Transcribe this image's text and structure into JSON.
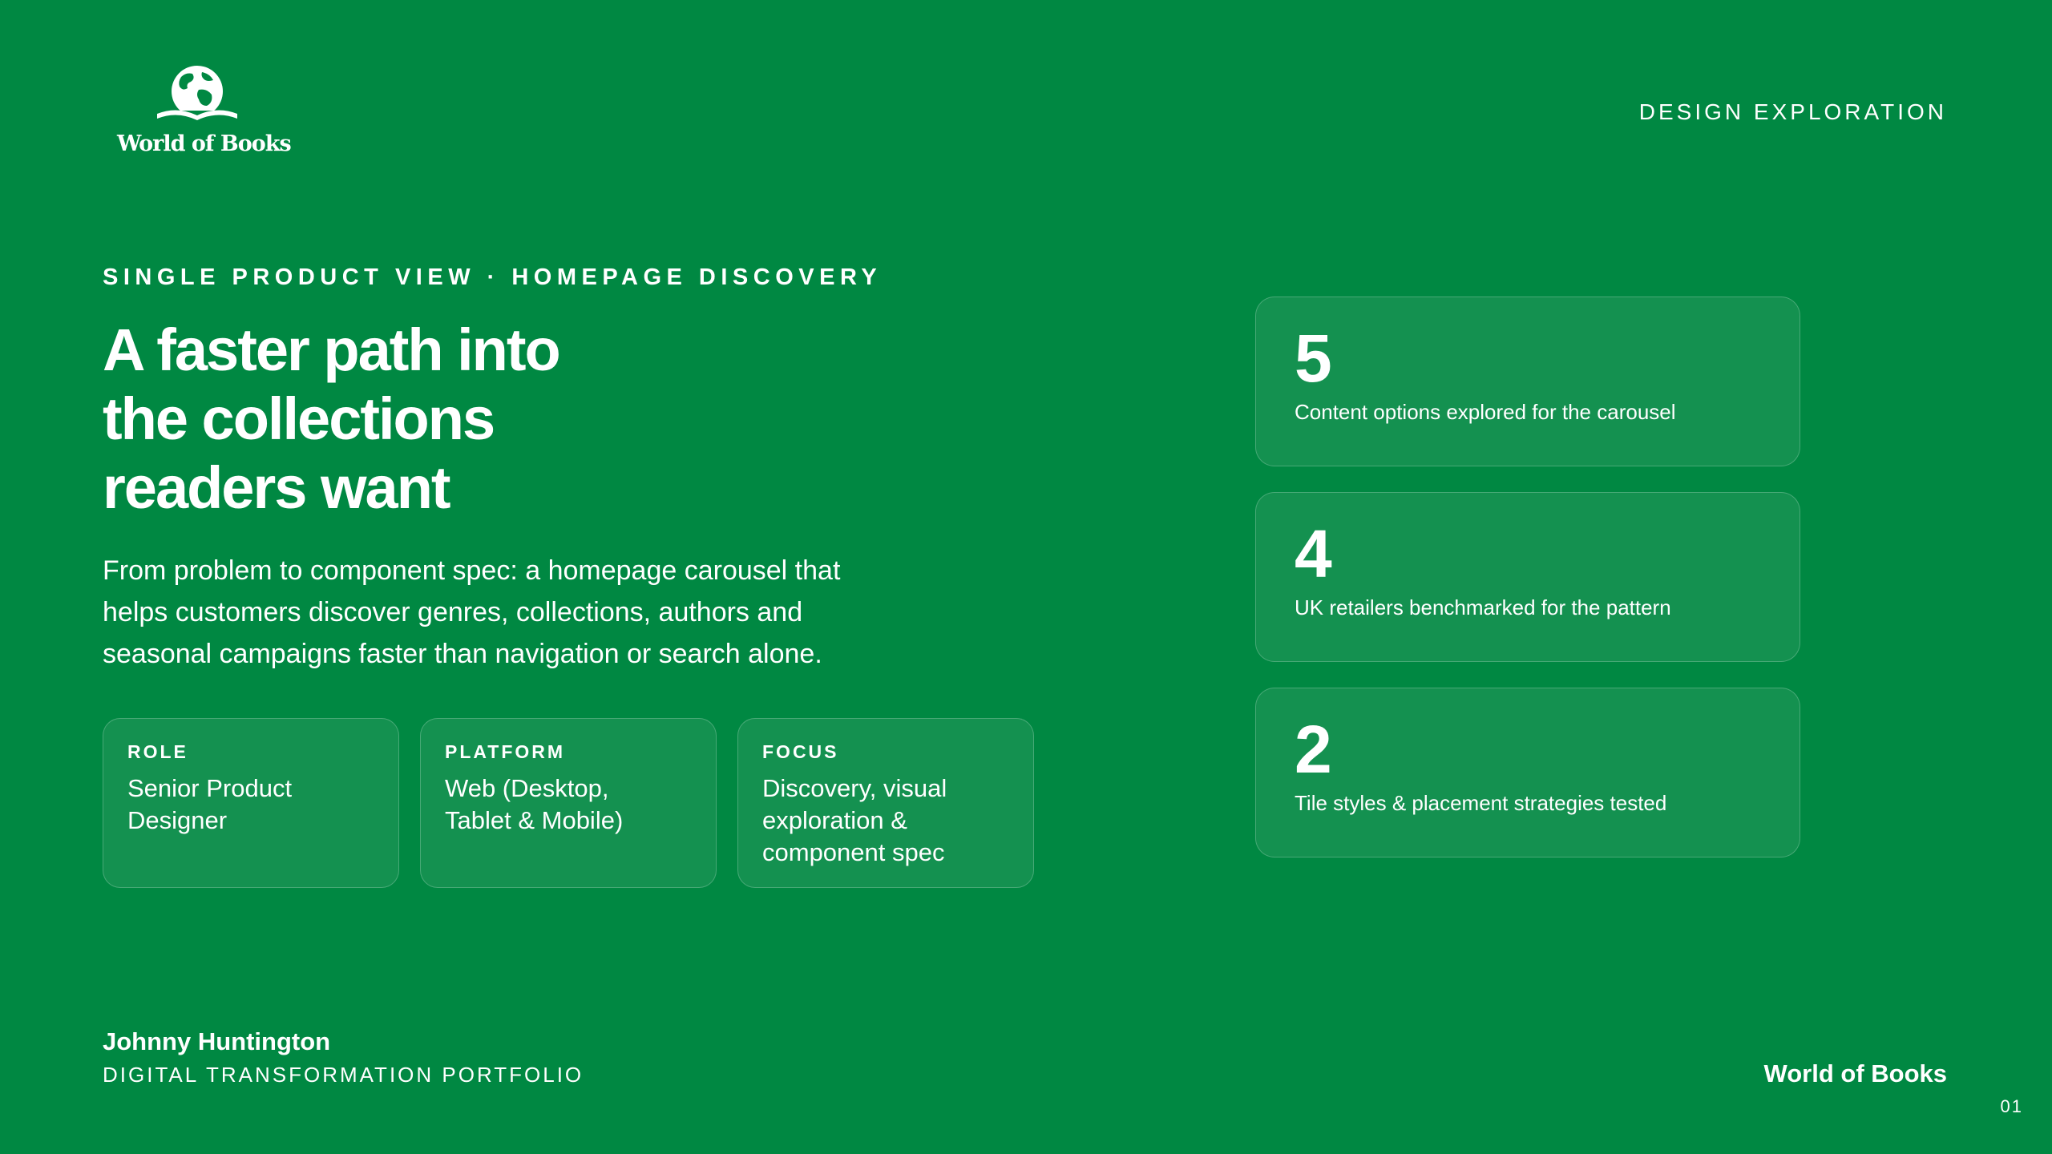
{
  "logo": {
    "text": "World of Books",
    "icon": "globe-book-icon"
  },
  "header": {
    "label": "DESIGN EXPLORATION"
  },
  "hero": {
    "eyebrow": "SINGLE PRODUCT VIEW · HOMEPAGE DISCOVERY",
    "headline_lines": [
      "A faster path into",
      "the collections",
      "readers want"
    ],
    "lead_lines": [
      "From problem to component spec: a homepage carousel that",
      "helps customers discover genres, collections, authors and",
      "seasonal campaigns faster than navigation or search alone."
    ]
  },
  "info_cards": [
    {
      "label": "ROLE",
      "value_lines": [
        "Senior Product",
        "Designer"
      ]
    },
    {
      "label": "PLATFORM",
      "value_lines": [
        "Web (Desktop,",
        "Tablet & Mobile)"
      ]
    },
    {
      "label": "FOCUS",
      "value_lines": [
        "Discovery, visual",
        "exploration &",
        "component spec"
      ]
    }
  ],
  "stats": [
    {
      "number": "5",
      "description": "Content options explored for the carousel"
    },
    {
      "number": "4",
      "description": "UK retailers benchmarked for the pattern"
    },
    {
      "number": "2",
      "description": "Tile styles & placement strategies tested"
    }
  ],
  "footer": {
    "author": "Johnny Huntington",
    "portfolio": "DIGITAL TRANSFORMATION PORTFOLIO",
    "brand": "World of Books",
    "page_number": "01"
  },
  "colors": {
    "background": "#008842",
    "text": "#ffffff",
    "card_fill": "rgba(255,255,255,0.08)"
  }
}
